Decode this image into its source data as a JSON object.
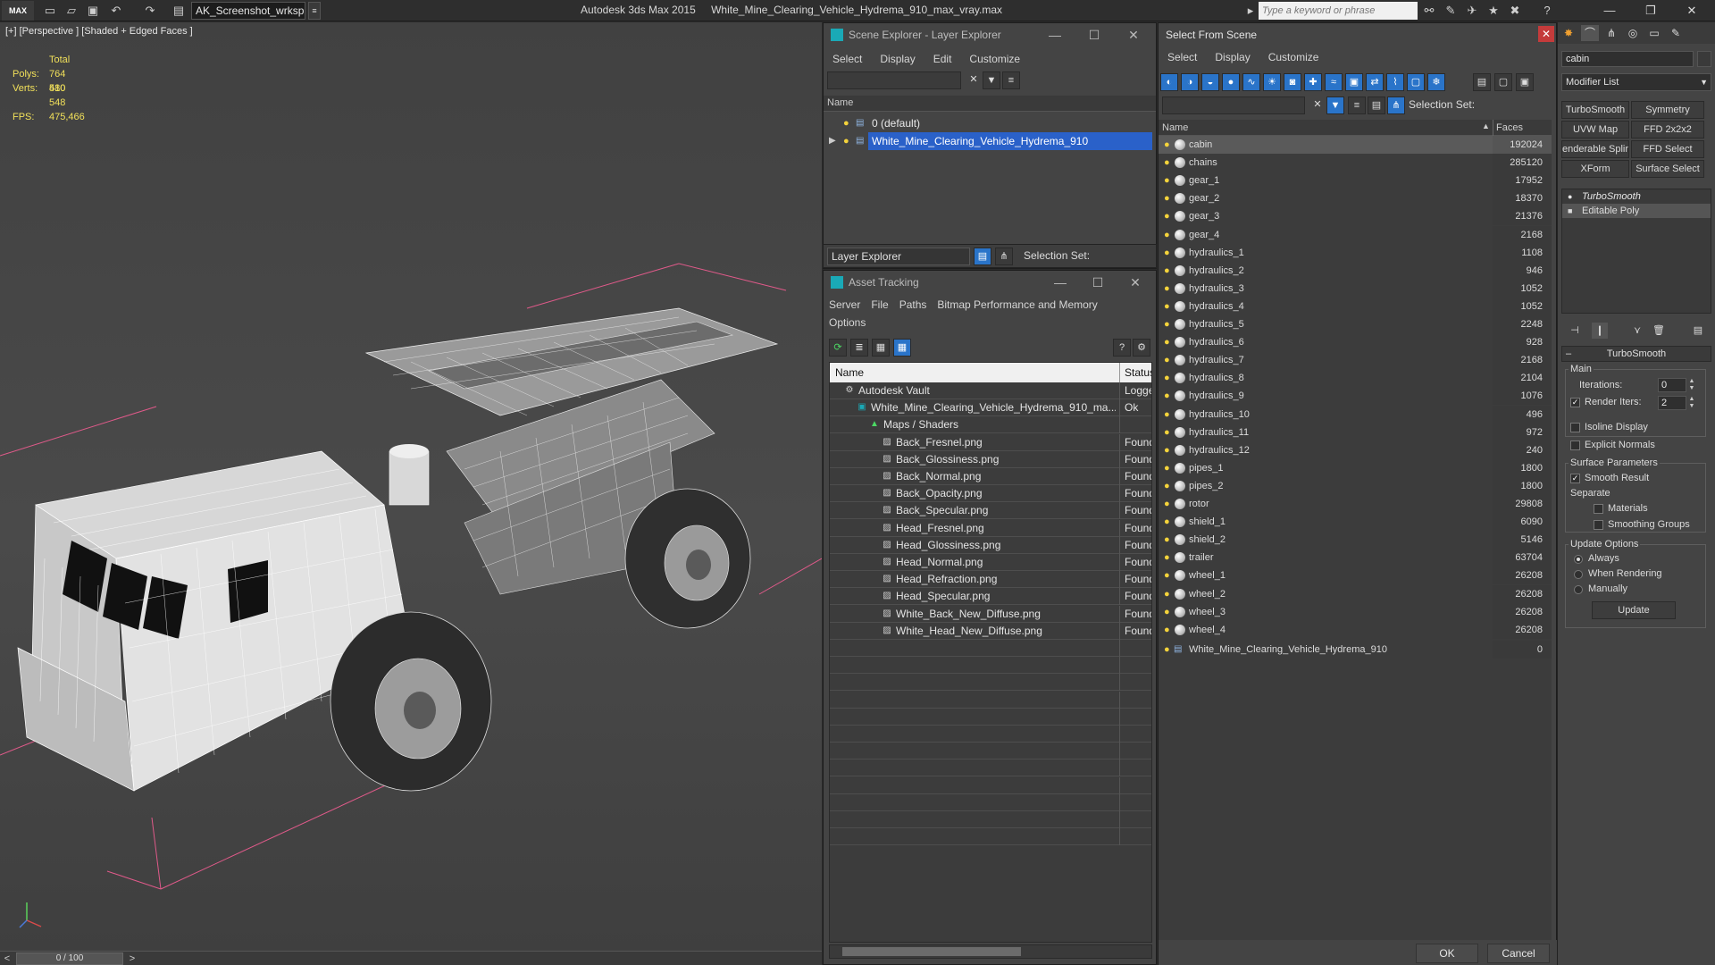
{
  "titlebar": {
    "logo": "MAX",
    "workspace": "AK_Screenshot_wrksp",
    "app_name": "Autodesk 3ds Max  2015",
    "file_name": "White_Mine_Clearing_Vehicle_Hydrema_910_max_vray.max",
    "search_placeholder": "Type a keyword or phrase"
  },
  "viewport": {
    "label": "[+] [Perspective ] [Shaded + Edged Faces ]",
    "stats": {
      "total_label": "Total",
      "polys_label": "Polys:",
      "polys": "764 580",
      "verts_label": "Verts:",
      "verts": "410 548",
      "fps_label": "FPS:",
      "fps": "475,466"
    },
    "colors": {
      "stats": "#f1e05a",
      "wire": "#ffffff",
      "box": "#e05a8a"
    }
  },
  "timeline": {
    "frame": "0 / 100",
    "prev": "<",
    "next": ">"
  },
  "scene_explorer": {
    "title": "Scene Explorer - Layer Explorer",
    "menu": [
      "Select",
      "Display",
      "Edit",
      "Customize"
    ],
    "column_name": "Name",
    "layers": [
      {
        "name": "0 (default)",
        "selected": false
      },
      {
        "name": "White_Mine_Clearing_Vehicle_Hydrema_910",
        "selected": true
      }
    ],
    "footer_dropdown": "Layer Explorer",
    "selection_set_label": "Selection Set:"
  },
  "asset_tracking": {
    "title": "Asset Tracking",
    "menu": [
      "Server",
      "File",
      "Paths",
      "Bitmap Performance and Memory"
    ],
    "menu2": [
      "Options"
    ],
    "columns": {
      "name": "Name",
      "status": "Status"
    },
    "rows": [
      {
        "name": "Autodesk Vault",
        "status": "Logged",
        "indent": 0,
        "icon": "vault-icon"
      },
      {
        "name": "White_Mine_Clearing_Vehicle_Hydrema_910_ma...",
        "status": "Ok",
        "indent": 1,
        "icon": "max-file-icon"
      },
      {
        "name": "Maps / Shaders",
        "status": "",
        "indent": 2,
        "icon": "maps-icon"
      },
      {
        "name": "Back_Fresnel.png",
        "status": "Found",
        "indent": 3,
        "icon": "bitmap-icon"
      },
      {
        "name": "Back_Glossiness.png",
        "status": "Found",
        "indent": 3,
        "icon": "bitmap-icon"
      },
      {
        "name": "Back_Normal.png",
        "status": "Found",
        "indent": 3,
        "icon": "bitmap-icon"
      },
      {
        "name": "Back_Opacity.png",
        "status": "Found",
        "indent": 3,
        "icon": "bitmap-icon"
      },
      {
        "name": "Back_Specular.png",
        "status": "Found",
        "indent": 3,
        "icon": "bitmap-icon"
      },
      {
        "name": "Head_Fresnel.png",
        "status": "Found",
        "indent": 3,
        "icon": "bitmap-icon"
      },
      {
        "name": "Head_Glossiness.png",
        "status": "Found",
        "indent": 3,
        "icon": "bitmap-icon"
      },
      {
        "name": "Head_Normal.png",
        "status": "Found",
        "indent": 3,
        "icon": "bitmap-icon"
      },
      {
        "name": "Head_Refraction.png",
        "status": "Found",
        "indent": 3,
        "icon": "bitmap-icon"
      },
      {
        "name": "Head_Specular.png",
        "status": "Found",
        "indent": 3,
        "icon": "bitmap-icon"
      },
      {
        "name": "White_Back_New_Diffuse.png",
        "status": "Found",
        "indent": 3,
        "icon": "bitmap-icon"
      },
      {
        "name": "White_Head_New_Diffuse.png",
        "status": "Found",
        "indent": 3,
        "icon": "bitmap-icon"
      }
    ]
  },
  "select_from_scene": {
    "title": "Select From Scene",
    "menu": [
      "Select",
      "Display",
      "Customize"
    ],
    "selection_set_label": "Selection Set:",
    "columns": {
      "name": "Name",
      "faces": "Faces"
    },
    "objects": [
      {
        "name": "cabin",
        "faces": "192024",
        "selected": true
      },
      {
        "name": "chains",
        "faces": "285120"
      },
      {
        "name": "gear_1",
        "faces": "17952"
      },
      {
        "name": "gear_2",
        "faces": "18370"
      },
      {
        "name": "gear_3",
        "faces": "21376"
      },
      {
        "name": "gear_4",
        "faces": "2168"
      },
      {
        "name": "hydraulics_1",
        "faces": "1108"
      },
      {
        "name": "hydraulics_2",
        "faces": "946"
      },
      {
        "name": "hydraulics_3",
        "faces": "1052"
      },
      {
        "name": "hydraulics_4",
        "faces": "1052"
      },
      {
        "name": "hydraulics_5",
        "faces": "2248"
      },
      {
        "name": "hydraulics_6",
        "faces": "928"
      },
      {
        "name": "hydraulics_7",
        "faces": "2168"
      },
      {
        "name": "hydraulics_8",
        "faces": "2104"
      },
      {
        "name": "hydraulics_9",
        "faces": "1076"
      },
      {
        "name": "hydraulics_10",
        "faces": "496"
      },
      {
        "name": "hydraulics_11",
        "faces": "972"
      },
      {
        "name": "hydraulics_12",
        "faces": "240"
      },
      {
        "name": "pipes_1",
        "faces": "1800"
      },
      {
        "name": "pipes_2",
        "faces": "1800"
      },
      {
        "name": "rotor",
        "faces": "29808"
      },
      {
        "name": "shield_1",
        "faces": "6090"
      },
      {
        "name": "shield_2",
        "faces": "5146"
      },
      {
        "name": "trailer",
        "faces": "63704"
      },
      {
        "name": "wheel_1",
        "faces": "26208"
      },
      {
        "name": "wheel_2",
        "faces": "26208"
      },
      {
        "name": "wheel_3",
        "faces": "26208"
      },
      {
        "name": "wheel_4",
        "faces": "26208"
      },
      {
        "name": "White_Mine_Clearing_Vehicle_Hydrema_910",
        "faces": "0",
        "is_layer": true
      }
    ],
    "ok": "OK",
    "cancel": "Cancel"
  },
  "command_panel": {
    "object_name": "cabin",
    "modifier_list": "Modifier List",
    "buttons": [
      "TurboSmooth",
      "Symmetry",
      "UVW Map",
      "FFD 2x2x2",
      "enderable Splir",
      "FFD Select",
      "XForm",
      "Surface Select"
    ],
    "stack": [
      {
        "name": "TurboSmooth",
        "italic": true
      },
      {
        "name": "Editable Poly",
        "selected": true
      }
    ],
    "turbosmooth": {
      "rollout": "TurboSmooth",
      "main": "Main",
      "iterations_label": "Iterations:",
      "iterations": "0",
      "render_iters_label": "Render Iters:",
      "render_iters": "2",
      "isoline": "Isoline Display",
      "explicit": "Explicit Normals",
      "surface_params": "Surface Parameters",
      "smooth_result": "Smooth Result",
      "separate": "Separate",
      "materials": "Materials",
      "smoothing_groups": "Smoothing Groups",
      "update_options": "Update Options",
      "always": "Always",
      "when_rendering": "When Rendering",
      "manually": "Manually",
      "update": "Update"
    }
  }
}
